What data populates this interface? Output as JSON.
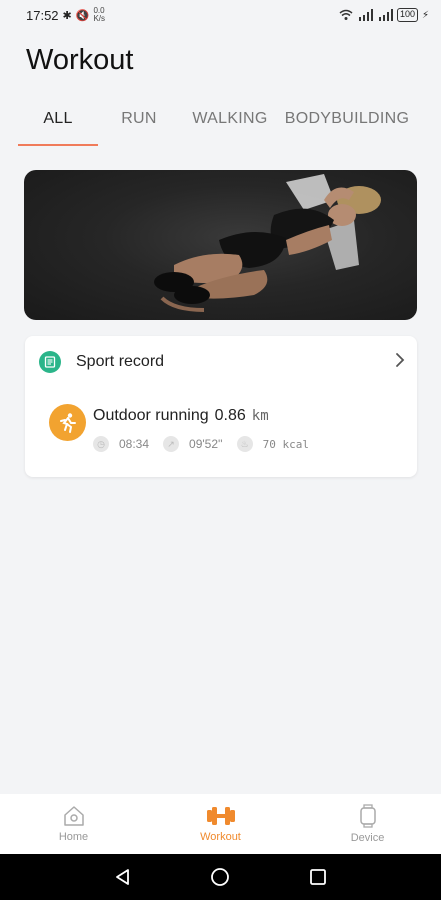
{
  "status_bar": {
    "time": "17:52",
    "speed_value": "0.0",
    "speed_unit": "K/s",
    "battery": "100"
  },
  "header": {
    "title": "Workout"
  },
  "tabs": [
    {
      "label": "ALL",
      "active": true
    },
    {
      "label": "RUN",
      "active": false
    },
    {
      "label": "WALKING",
      "active": false
    },
    {
      "label": "BODYBUILDING",
      "active": false
    }
  ],
  "sport_record": {
    "title": "Sport record",
    "entry": {
      "activity": "Outdoor running",
      "distance": "0.86",
      "unit": "km",
      "duration": "08:34",
      "pace": "09'52''",
      "calories": "70 kcal"
    }
  },
  "bottom_nav": [
    {
      "label": "Home",
      "icon": "home-icon"
    },
    {
      "label": "Workout",
      "icon": "dumbbell-icon",
      "active": true
    },
    {
      "label": "Device",
      "icon": "watch-icon"
    }
  ],
  "colors": {
    "accent": "#f07b5a",
    "active_nav": "#f08a2d",
    "record_icon": "#2bb58a",
    "run_icon": "#f2a330"
  }
}
